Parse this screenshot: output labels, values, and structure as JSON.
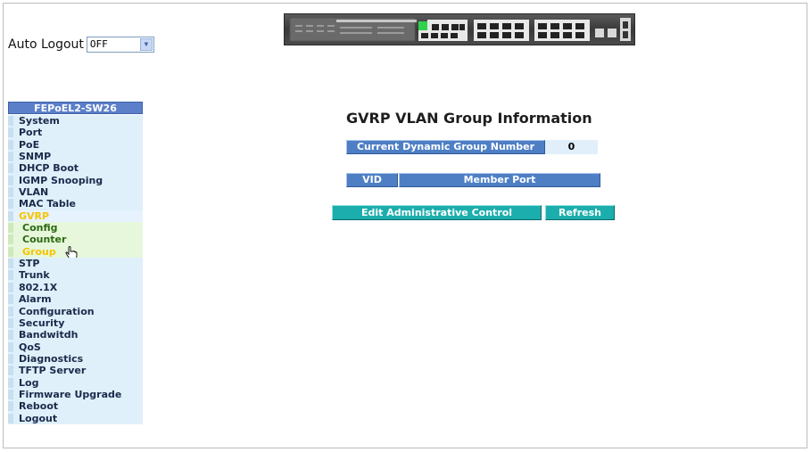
{
  "auto_logout": {
    "label": "Auto Logout",
    "value": "OFF"
  },
  "sidebar": {
    "title": "FEPoEL2-SW26",
    "items": [
      {
        "label": "System"
      },
      {
        "label": "Port"
      },
      {
        "label": "PoE"
      },
      {
        "label": "SNMP"
      },
      {
        "label": "DHCP Boot"
      },
      {
        "label": "IGMP Snooping"
      },
      {
        "label": "VLAN"
      },
      {
        "label": "MAC Table"
      },
      {
        "label": "GVRP"
      },
      {
        "label": "Config"
      },
      {
        "label": "Counter"
      },
      {
        "label": "Group"
      },
      {
        "label": "STP"
      },
      {
        "label": "Trunk"
      },
      {
        "label": "802.1X"
      },
      {
        "label": "Alarm"
      },
      {
        "label": "Configuration"
      },
      {
        "label": "Security"
      },
      {
        "label": "Bandwitdh"
      },
      {
        "label": "QoS"
      },
      {
        "label": "Diagnostics"
      },
      {
        "label": "TFTP Server"
      },
      {
        "label": "Log"
      },
      {
        "label": "Firmware Upgrade"
      },
      {
        "label": "Reboot"
      },
      {
        "label": "Logout"
      }
    ]
  },
  "main": {
    "title": "GVRP VLAN Group Information",
    "dynamic_group": {
      "label": "Current Dynamic Group Number",
      "value": "0"
    },
    "table": {
      "col_vid": "VID",
      "col_member_port": "Member Port"
    },
    "buttons": {
      "edit": "Edit Administrative Control",
      "refresh": "Refresh"
    }
  },
  "colors": {
    "header_blue": "#4e7fc4",
    "button_teal": "#1caeac",
    "nav_active": "#f6c400"
  },
  "icons": {
    "cursor": "hand-pointer-icon"
  }
}
